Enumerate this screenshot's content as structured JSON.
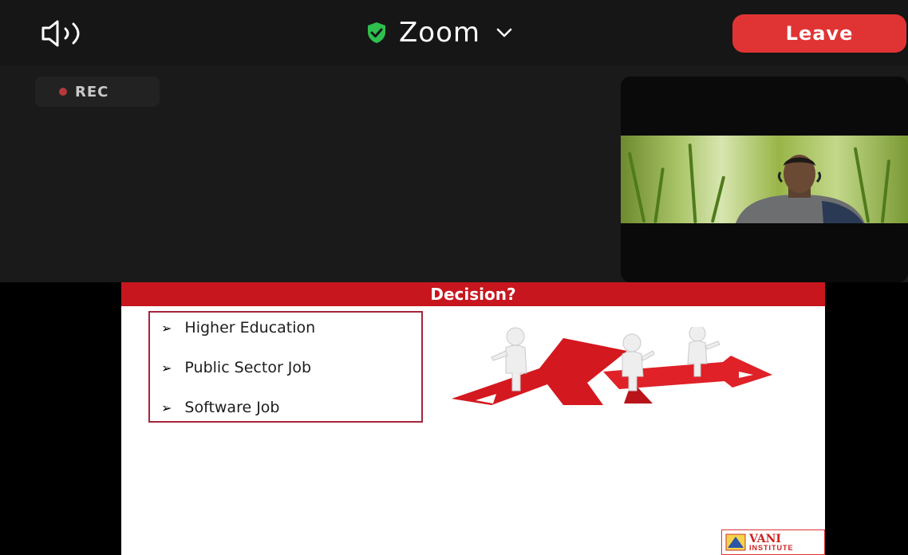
{
  "topbar": {
    "app_title": "Zoom",
    "leave_label": "Leave",
    "speaker_icon": "speaker-icon",
    "secure_icon": "shield-check-icon",
    "dropdown_icon": "chevron-down-icon"
  },
  "meeting": {
    "rec_label": "REC",
    "rec_color": "#b3393c"
  },
  "slide": {
    "title": "Decision?",
    "header_color": "#c8161e",
    "bullets": [
      "Higher Education",
      "Public Sector Job",
      "Software Job"
    ],
    "bullet_marker": "➢",
    "logo": {
      "name": "VANI",
      "subtitle": "INSTITUTE"
    }
  },
  "colors": {
    "leave": "#e03434",
    "shield": "#2fbf4f",
    "background": "#1a1a1a"
  }
}
